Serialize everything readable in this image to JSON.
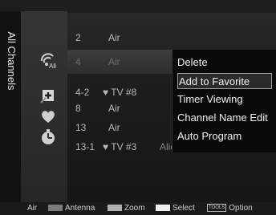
{
  "sidebar": {
    "title": "All Channels"
  },
  "filter": {
    "all_label": "All"
  },
  "channels": [
    {
      "num": "2",
      "type": "Air",
      "name": ""
    },
    {
      "num": "4",
      "type": "Air",
      "name": ""
    },
    {
      "num": "4-2",
      "type": "♥ TV #8",
      "name": ""
    },
    {
      "num": "8",
      "type": "Air",
      "name": ""
    },
    {
      "num": "13",
      "type": "Air",
      "name": ""
    },
    {
      "num": "13-1",
      "type": "♥ TV #3",
      "name": "Alice"
    }
  ],
  "menu": {
    "items": [
      "Delete",
      "Add to Favorite",
      "Timer Viewing",
      "Channel Name Edit",
      "Auto Program"
    ],
    "focused_index": 1
  },
  "bottom_bar": {
    "source": "Air",
    "antenna_label": "Antenna",
    "zoom_label": "Zoom",
    "select_label": "Select",
    "tools_label": "TOOLS",
    "option_label": "Option",
    "colors": {
      "antenna": "#7a7a7a",
      "zoom": "#b0b0b0",
      "select": "#f0f0f0"
    }
  },
  "icons": [
    "all-filter-icon",
    "add-channel-icon",
    "favorite-heart-icon",
    "timer-clock-icon"
  ]
}
